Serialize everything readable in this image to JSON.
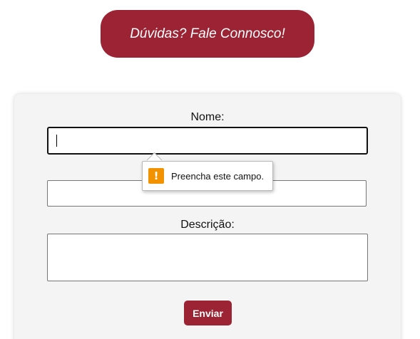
{
  "banner": {
    "text": "Dúvidas? Fale Connosco!"
  },
  "form": {
    "name_label": "Nome:",
    "name_value": "",
    "email_value": "",
    "description_label": "Descrição:",
    "description_value": "",
    "submit_label": "Enviar"
  },
  "validation": {
    "message": "Preencha este campo.",
    "icon": "warning-icon"
  },
  "colors": {
    "accent": "#9b2333",
    "warning": "#f39200",
    "card_background": "#f4f4f4"
  }
}
